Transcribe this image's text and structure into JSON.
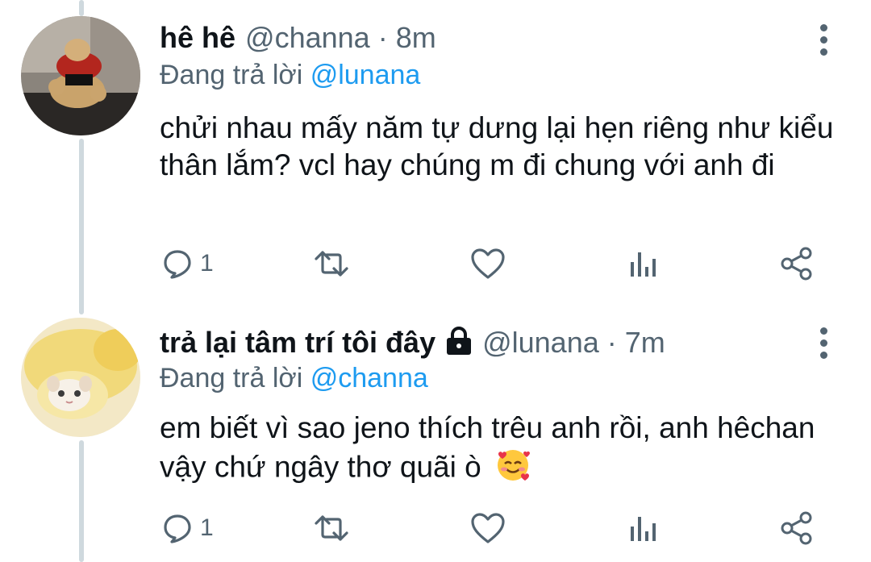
{
  "tweets": [
    {
      "name": "hê hê",
      "handle": "@channa",
      "dot": "·",
      "time": "8m",
      "replying_prefix": "Đang trả lời ",
      "replying_to": "@lunana",
      "text": "chửi nhau mấy năm tự dưng lại hẹn riêng như kiểu thân lắm? vcl hay chúng m đi chung với anh đi",
      "reply_count": "1",
      "icons": [
        "reply-icon",
        "retweet-icon",
        "like-icon",
        "analytics-icon",
        "share-icon"
      ]
    },
    {
      "name": "trả lại tâm trí tôi đây",
      "protected": true,
      "handle": "@lunana",
      "dot": "·",
      "time": "7m",
      "replying_prefix": "Đang trả lời ",
      "replying_to": "@channa",
      "text": "em biết vì sao jeno thích trêu anh rồi, anh hêchan vậy chứ ngây thơ quãi ò",
      "emoji": "smiling-face-with-hearts",
      "reply_count": "1",
      "icons": [
        "reply-icon",
        "retweet-icon",
        "like-icon",
        "analytics-icon",
        "share-icon"
      ]
    }
  ],
  "colors": {
    "text": "#0f1419",
    "secondary": "#536471",
    "mention": "#1d9bf0",
    "thread_line": "#cfd9de"
  }
}
